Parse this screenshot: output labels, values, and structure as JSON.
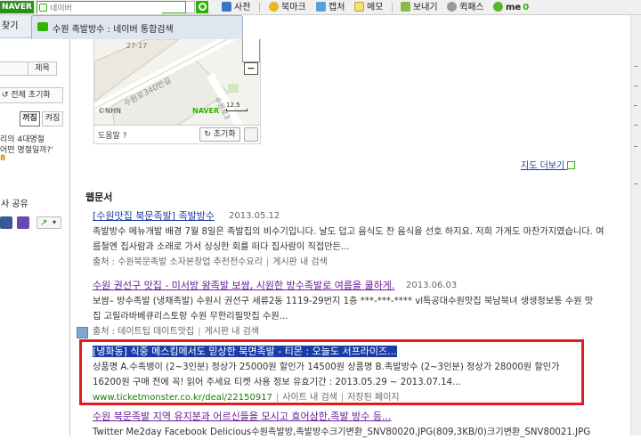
{
  "toolbar": {
    "logo": "NAVER",
    "search_placeholder": "네이버",
    "items": [
      {
        "label": "사전",
        "icon": "dictionary-icon"
      },
      {
        "label": "북마크",
        "icon": "bookmark-icon"
      },
      {
        "label": "캡처",
        "icon": "capture-icon"
      },
      {
        "label": "메모",
        "icon": "memo-icon"
      },
      {
        "label": "보내기",
        "icon": "send-icon"
      },
      {
        "label": "퀵패스",
        "icon": "quickpass-icon"
      },
      {
        "label": "me",
        "icon": "me-icon"
      }
    ],
    "me_count": "0"
  },
  "tab": {
    "title": "수원 족발방수 : 네이버 통합검색"
  },
  "sidebar": {
    "head": "찾기",
    "btn_title": "제목",
    "reset": "전체 초기화",
    "toggle_on": "꺼짐",
    "toggle_off": "켜짐",
    "promo_line1": "리의 4대명절",
    "promo_line2": "어떤 명절일까?'",
    "promo_line3": "8",
    "share_label": "사 공유"
  },
  "map": {
    "block_num": "27-17",
    "road_label": "수원로340번길",
    "road_label2": "수원로3",
    "logo": "NAVER",
    "nhn": "©NHN",
    "scale": "12.5",
    "help": "도움말 ?",
    "reset": "초기화",
    "more": "지도 더보기"
  },
  "section": {
    "title": "웹문서"
  },
  "results": [
    {
      "title": "[수원맛집 북문족발] 족발방수",
      "date": "2013.05.12",
      "desc": "족발방수 메뉴개발 배경 7월 8일은 족발집의 비수기입니다. 날도 덥고 음식도 찬 음식을 선호 하지요. 저희 가게도 마찬가지였습니다. 여름철엔 집사람과 소래로 가서 싱싱한 회를 떠다 집사람이 직접만든...",
      "src": "출처 : 수원북문족발 소자본창업 추천전수요리",
      "extra": "게시판 내 검색"
    },
    {
      "title": "수원 권선구 맛집 - 미서방 왕족발 보쌈, 시원한 방수족발로 여름을 쿨하게.",
      "date": "2013.06.03",
      "desc": "보쌈– 방수족발 (냉채족발) 수원시 권선구 세류2동 1119-29번지 1층 ***-***-**** vl특공대수원맛집 북남북녀 생생정보통 수원 맛집 고릴라바베큐리스토랑 수원 무한리필맛집 수원...",
      "src": "출처 : 데이트팁 데이트맛집",
      "extra": "게시판 내 검색"
    },
    {
      "title": "[냉화동] 식중 메스킴메서도 믿상한 북면족발 - 티몬 : 오늘도 서프라이즈...",
      "date": "",
      "desc": "상품명 A.수족뱅이 (2~3인분) 정상가 25000원 할인가 14500원 상품명 B.족발방수 (2~3인분) 정상가 28000원 할인가 16200원 구매 전에 꼭! 읽어 주세요 티켓 사용 정보 유효기간 : 2013.05.29 ~ 2013.07.14...",
      "src": "www.ticketmonster.co.kr/deal/22150917",
      "extra": "사이트 내 검색",
      "extra2": "저장된 페이지"
    },
    {
      "title": "수원 북문족발 지역 유지분과 어르신들을 모시고 효어삼한,족발 방수 등...",
      "date": "",
      "desc": "Twitter Me2day Facebook Delicious수원족발방,족발방수크기변환_SNV80020.JPG(809,3KB/0)크기변환_SNV80021.JPG(75",
      "src": "",
      "extra": ""
    }
  ],
  "colors": {
    "accent": "#2db400",
    "link": "#1a3ca6",
    "visited": "#6a1a9a",
    "highlight": "#e11c1c"
  }
}
